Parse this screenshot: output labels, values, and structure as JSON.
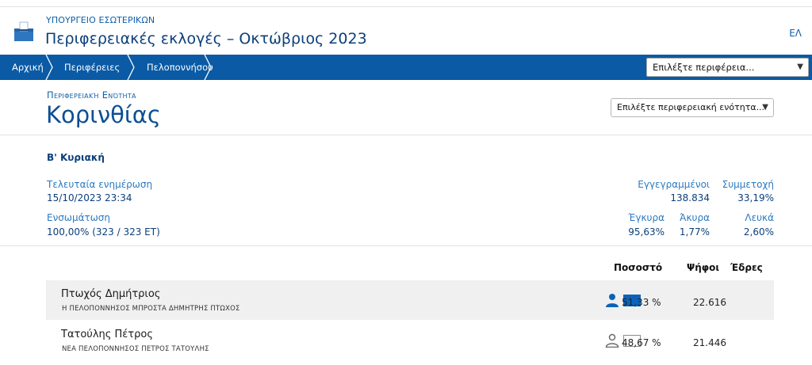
{
  "header": {
    "ministry": "ΥΠΟΥΡΓΕΙΟ ΕΣΩΤΕΡΙΚΩΝ",
    "title": "Περιφερειακές εκλογές – Οκτώβριος 2023",
    "lang": "ΕΛ"
  },
  "nav": {
    "crumbs": [
      "Αρχική",
      "Περιφέρειες",
      "Πελοποννήσου"
    ],
    "region_select": "Επιλέξτε περιφέρεια..."
  },
  "unit": {
    "subtitle": "Περιφερειακή Ενότητα",
    "name": "Κορινθίας",
    "select": "Επιλέξτε περιφερειακή ενότητα..."
  },
  "summary": {
    "round": "Β' Κυριακή",
    "last_update_label": "Τελευταία ενημέρωση",
    "last_update_value": "15/10/2023 23:34",
    "incorporation_label": "Ενσωμάτωση",
    "incorporation_value": "100,00% (323 / 323 ΕΤ)",
    "registered_label": "Εγγεγραμμένοι",
    "registered_value": "138.834",
    "turnout_label": "Συμμετοχή",
    "turnout_value": "33,19%",
    "valid_label": "Έγκυρα",
    "valid_value": "95,63%",
    "invalid_label": "Άκυρα",
    "invalid_value": "1,77%",
    "blank_label": "Λευκά",
    "blank_value": "2,60%"
  },
  "table": {
    "headers": {
      "percent": "Ποσοστό",
      "votes": "Ψήφοι",
      "seats": "Έδρες"
    },
    "rows": [
      {
        "name": "Πτωχός Δημήτριος",
        "party": "Η ΠΕΛΟΠΟΝΝΗΣΟΣ ΜΠΡΟΣΤΑ ΔΗΜΗΤΡΗΣ ΠΤΩΧΟΣ",
        "percent": "51,33 %",
        "votes": "22.616",
        "seats": "",
        "elected": true,
        "color": "#0a63b8"
      },
      {
        "name": "Τατούλης Πέτρος",
        "party": "ΝΕΑ ΠΕΛΟΠΟΝΝΗΣΟΣ ΠΕΤΡΟΣ ΤΑΤΟΥΛΗΣ",
        "percent": "48,67 %",
        "votes": "21.446",
        "seats": "",
        "elected": false,
        "color": "#ffffff"
      }
    ]
  },
  "colors": {
    "nav": "#0a5aa5",
    "accent": "#0b4f94",
    "label": "#2c79c1"
  },
  "icons": [
    "ballot-box-icon",
    "chevron-right-icon",
    "chevron-down-icon",
    "person-icon"
  ]
}
